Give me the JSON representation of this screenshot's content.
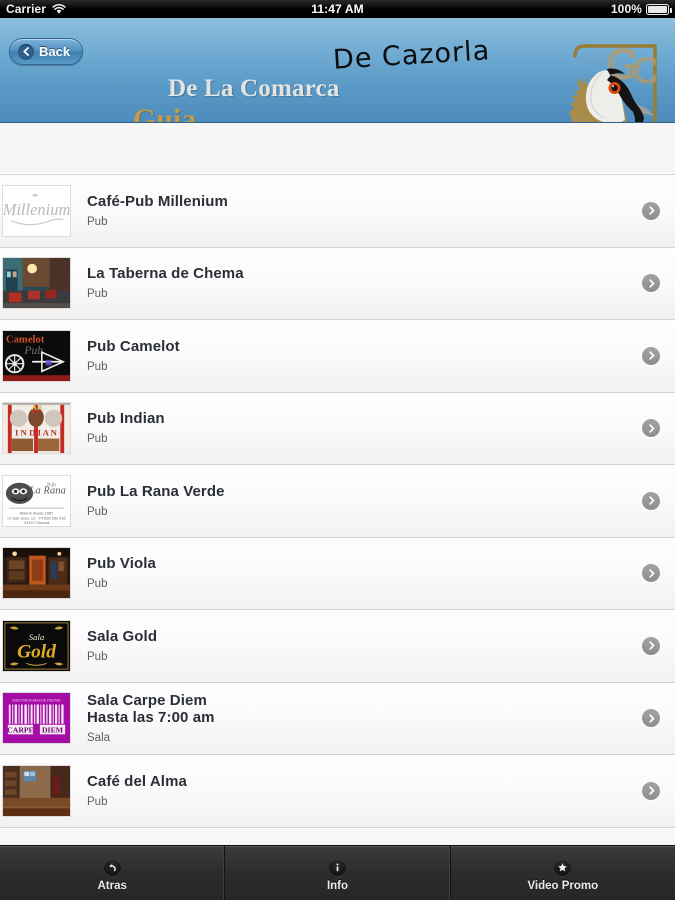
{
  "status_bar": {
    "carrier": "Carrier",
    "wifi_icon": "wifi-icon",
    "time": "11:47 AM",
    "battery_percent": "100%",
    "battery_icon": "battery-full-icon"
  },
  "nav_bar": {
    "back_label": "Back",
    "back_icon": "chevron-left-icon",
    "brand_line_cazorla": "De Cazorla",
    "brand_line_comarca": "De La Comarca",
    "brand_line_guia": "Guia",
    "logo_icon": "bearded-vulture-logo-icon",
    "colors": {
      "nav_top": "#8fbede",
      "nav_bottom": "#4d8cbb",
      "guia_gold": "#c59b49",
      "comarca_grey": "#e3e3e0"
    }
  },
  "list": {
    "disclosure_icon": "chevron-right-icon",
    "items": [
      {
        "title_lines": [
          "Café-Pub Millenium"
        ],
        "subtitle": "Pub",
        "thumb_name": "thumb-cafe-pub-millenium",
        "thumb_kind": "logo-millenium"
      },
      {
        "title_lines": [
          "La Taberna de Chema"
        ],
        "subtitle": "Pub",
        "thumb_name": "thumb-la-taberna-de-chema",
        "thumb_kind": "photo-taberna"
      },
      {
        "title_lines": [
          "Pub Camelot"
        ],
        "subtitle": "Pub",
        "thumb_name": "thumb-pub-camelot",
        "thumb_kind": "logo-camelot"
      },
      {
        "title_lines": [
          "Pub Indian"
        ],
        "subtitle": "Pub",
        "thumb_name": "thumb-pub-indian",
        "thumb_kind": "poster-indian"
      },
      {
        "title_lines": [
          "Pub La Rana Verde"
        ],
        "subtitle": "Pub",
        "thumb_name": "thumb-pub-la-rana-verde",
        "thumb_kind": "card-rana-verde"
      },
      {
        "title_lines": [
          "Pub Viola"
        ],
        "subtitle": "Pub",
        "thumb_name": "thumb-pub-viola",
        "thumb_kind": "photo-viola"
      },
      {
        "title_lines": [
          "Sala Gold"
        ],
        "subtitle": "Pub",
        "thumb_name": "thumb-sala-gold",
        "thumb_kind": "logo-gold"
      },
      {
        "title_lines": [
          "Sala Carpe Diem",
          "Hasta las 7:00 am"
        ],
        "subtitle": "Sala",
        "thumb_name": "thumb-sala-carpe-diem",
        "thumb_kind": "logo-carpe-diem"
      },
      {
        "title_lines": [
          "Café del Alma"
        ],
        "subtitle": "Pub",
        "thumb_name": "thumb-cafe-del-alma",
        "thumb_kind": "photo-alma"
      }
    ]
  },
  "toolbar": {
    "buttons": [
      {
        "label": "Atras",
        "icon": "back-arrow-circle-icon",
        "name": "toolbar-atras"
      },
      {
        "label": "Info",
        "icon": "info-circle-icon",
        "name": "toolbar-info"
      },
      {
        "label": "Video Promo",
        "icon": "star-circle-icon",
        "name": "toolbar-video-promo"
      }
    ]
  }
}
